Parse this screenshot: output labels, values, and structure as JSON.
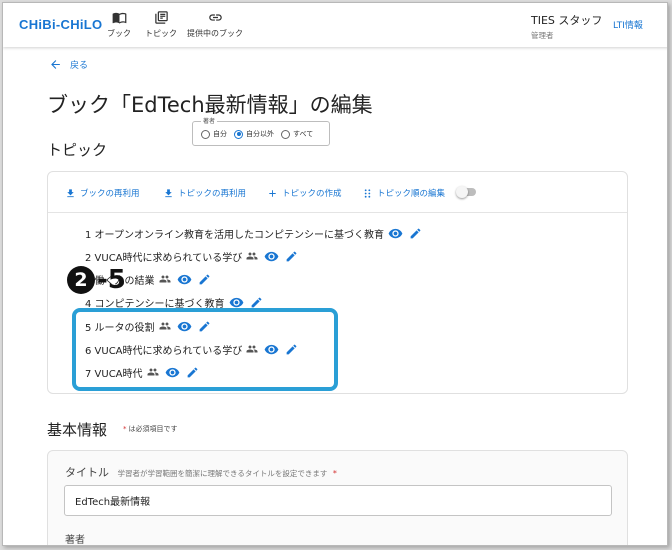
{
  "app": {
    "logo": "CHiBi-CHiLO",
    "nav": [
      {
        "label": "ブック",
        "icon": "book-icon"
      },
      {
        "label": "トピック",
        "icon": "topic-icon"
      },
      {
        "label": "提供中のブック",
        "icon": "link-icon"
      }
    ],
    "user": {
      "name": "TIES スタッフ",
      "role": "管理者"
    },
    "lti_label": "LTI情報"
  },
  "page": {
    "back_label": "戻る",
    "title": "ブック「EdTech最新情報」の編集"
  },
  "author_filter": {
    "label": "著者",
    "options": [
      "自分",
      "自分以外",
      "すべて"
    ],
    "selected": "自分以外"
  },
  "topics_section": {
    "title": "トピック",
    "toolbar": [
      {
        "label": "ブックの再利用",
        "icon": "download-icon"
      },
      {
        "label": "トピックの再利用",
        "icon": "download-icon"
      },
      {
        "label": "トピックの作成",
        "icon": "plus-icon"
      },
      {
        "label": "トピック順の編集",
        "icon": "drag-handle-icon"
      }
    ],
    "items": [
      {
        "label": "1 オープンオンライン教育を活用したコンピテンシーに基づく教育",
        "shared": false
      },
      {
        "label": "2 VUCA時代に求められている学び",
        "shared": true
      },
      {
        "label": "3 働く人の結業",
        "shared": true
      },
      {
        "label": "4 コンピテンシーに基づく教育",
        "shared": false
      },
      {
        "label": "5 ルータの役割",
        "shared": true
      },
      {
        "label": "6 VUCA時代に求められている学び",
        "shared": true
      },
      {
        "label": "7 VUCA時代",
        "shared": true
      }
    ]
  },
  "callout": {
    "num": "2",
    "suffix": "-5"
  },
  "basic_info": {
    "title": "基本情報",
    "required_note": "は必須項目です",
    "title_field": {
      "label": "タイトル",
      "help": "学習者が学習範囲を簡潔に理解できるタイトルを設定できます",
      "value": "EdTech最新情報"
    },
    "author_label": "著者"
  },
  "colors": {
    "accent": "#1976d2",
    "highlight": "#2a9fd6",
    "required": "#d32f2f"
  }
}
